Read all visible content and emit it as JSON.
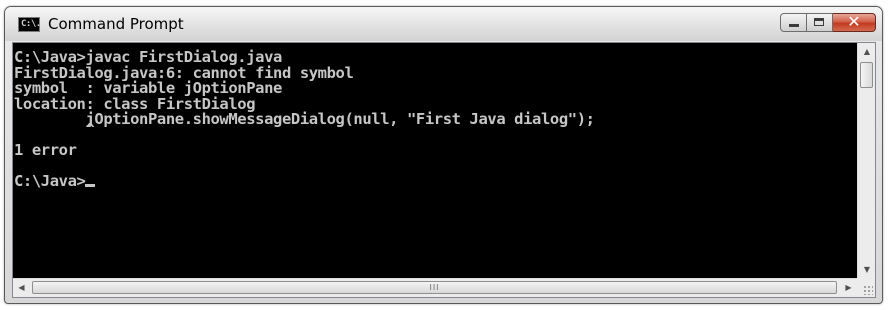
{
  "window": {
    "title": "Command Prompt",
    "icon_name": "console-icon",
    "icon_text": "C:\\."
  },
  "caption_buttons": {
    "minimize": "minimize",
    "maximize": "maximize",
    "close": "close"
  },
  "console": {
    "lines": [
      "C:\\Java>javac FirstDialog.java",
      "FirstDialog.java:6: cannot find symbol",
      "symbol  : variable jOptionPane",
      "location: class FirstDialog",
      "        jOptionPane.showMessageDialog(null, \"First Java dialog\");",
      "        ^",
      "1 error",
      "",
      "C:\\Java>"
    ],
    "text_color": "#c6c6c6",
    "background_color": "#000000"
  },
  "scrollbars": {
    "vertical": {
      "up_arrow": "▲",
      "down_arrow": "▼"
    },
    "horizontal": {
      "left_arrow": "◀",
      "right_arrow": "▶",
      "grip": "III"
    }
  },
  "colors": {
    "close_button": "#c23a22",
    "frame": "#d7d7d7"
  }
}
